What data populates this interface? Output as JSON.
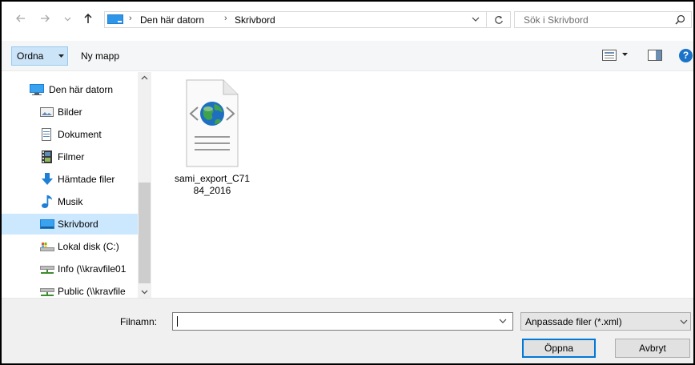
{
  "address_bar": {
    "back_icon": "arrow-left-icon",
    "forward_icon": "arrow-right-icon",
    "recent_icon": "chevron-down-icon",
    "up_icon": "arrow-up-icon",
    "breadcrumbs": [
      "Den här datorn",
      "Skrivbord"
    ],
    "separator": "›",
    "refresh_icon": "refresh-icon"
  },
  "search": {
    "placeholder": "Sök i Skrivbord",
    "icon": "search-icon"
  },
  "toolbar": {
    "organize_label": "Ordna",
    "new_folder_label": "Ny mapp",
    "help_label": "?"
  },
  "nav_pane": {
    "items": [
      {
        "label": "Den här datorn",
        "icon": "computer-icon",
        "selected": false
      },
      {
        "label": "Bilder",
        "icon": "pictures-icon",
        "selected": false
      },
      {
        "label": "Dokument",
        "icon": "documents-icon",
        "selected": false
      },
      {
        "label": "Filmer",
        "icon": "videos-icon",
        "selected": false
      },
      {
        "label": "Hämtade filer",
        "icon": "downloads-icon",
        "selected": false
      },
      {
        "label": "Musik",
        "icon": "music-icon",
        "selected": false
      },
      {
        "label": "Skrivbord",
        "icon": "desktop-icon",
        "selected": true
      },
      {
        "label": "Lokal disk (C:)",
        "icon": "local-disk-icon",
        "selected": false
      },
      {
        "label": "Info (\\\\kravfile01",
        "icon": "network-drive-icon",
        "selected": false
      },
      {
        "label": "Public (\\\\kravfile",
        "icon": "network-drive-icon",
        "selected": false
      }
    ]
  },
  "files": [
    {
      "name": "sami_export_C7184_2016",
      "icon": "xml-file-icon"
    }
  ],
  "bottom": {
    "filename_label": "Filnamn:",
    "filename_value": "",
    "filetype_label": "Anpassade filer (*.xml)",
    "open_label": "Öppna",
    "cancel_label": "Avbryt"
  },
  "colors": {
    "selected_bg": "#cce8ff",
    "organize_bg": "#cce4f7",
    "accent": "#0078d7",
    "toolbar_bg": "#f5f6f7",
    "footer_bg": "#f0f0f0"
  }
}
